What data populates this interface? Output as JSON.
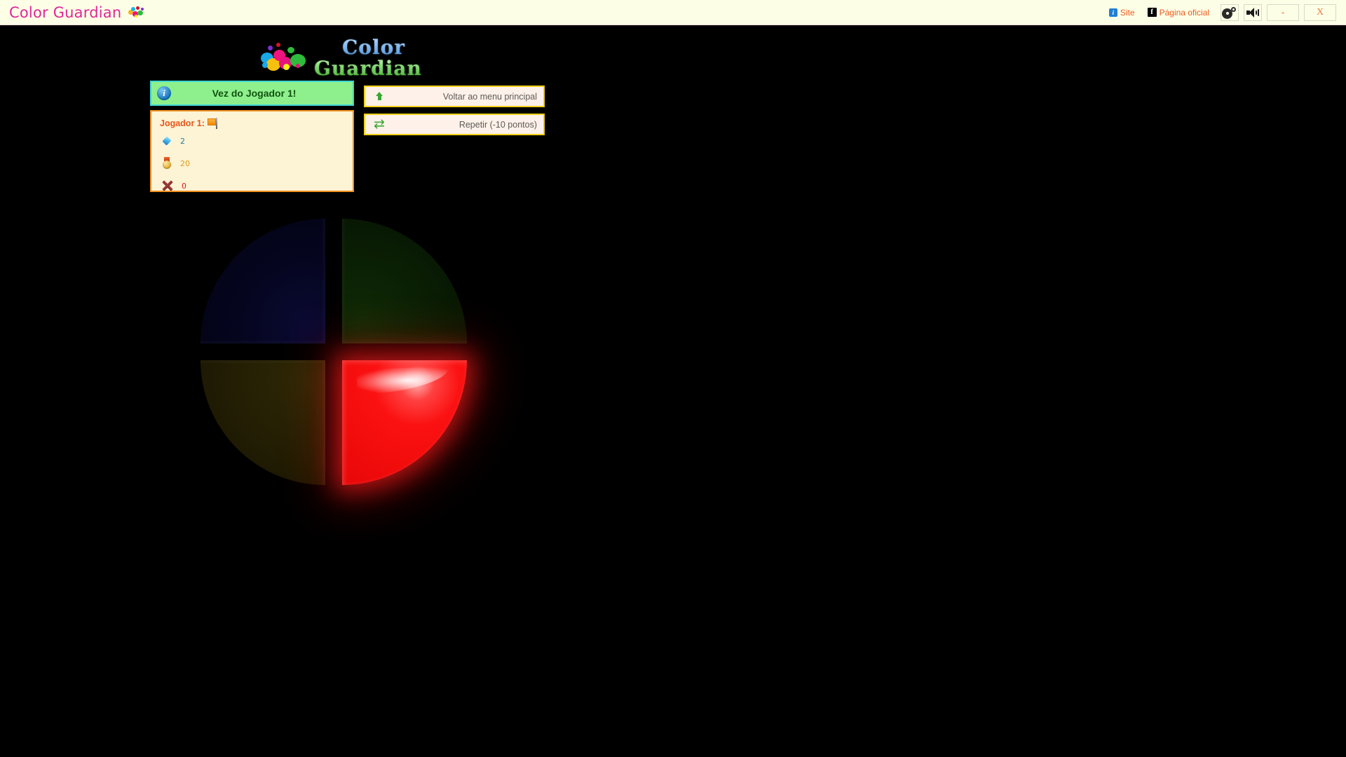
{
  "titlebar": {
    "app_title": "Color Guardian",
    "logo_icon": "paint-splatter-icon",
    "links": [
      {
        "label": "Site",
        "icon": "info-square-icon"
      },
      {
        "label": "Página oficial",
        "icon": "facebook-icon"
      }
    ],
    "buttons": [
      {
        "name": "settings-button",
        "icon": "gear-icon",
        "label": ""
      },
      {
        "name": "sound-button",
        "icon": "speaker-icon",
        "label": ""
      },
      {
        "name": "minimize-button",
        "icon": "minimize-icon",
        "label": "-"
      },
      {
        "name": "close-button",
        "icon": "close-icon",
        "label": "X"
      }
    ]
  },
  "logo": {
    "line1": "Color",
    "line2": "Guardian",
    "icon": "paint-splatter-icon"
  },
  "status": {
    "icon": "info-circle-icon",
    "text": "Vez do Jogador 1!",
    "banner_bg": "#8EF08D",
    "banner_border": "#3FD5D3"
  },
  "player_panel": {
    "player_label": "Jogador 1:",
    "flag_icon": "flag-icon",
    "panel_bg": "#FDF3D5",
    "panel_border": "#F0901E",
    "stats": [
      {
        "icon": "gem-icon",
        "value": "2",
        "color": "#1A7F9E"
      },
      {
        "icon": "medal-icon",
        "value": "20",
        "color": "#E09A16"
      },
      {
        "icon": "x-mark-icon",
        "value": "0",
        "color": "#E01B1B"
      }
    ]
  },
  "actions": [
    {
      "name": "back-to-main-menu-button",
      "label": "Voltar ao menu principal",
      "icon": "up-arrow-icon"
    },
    {
      "name": "repeat-button",
      "label": "Repetir (-10 pontos)",
      "icon": "refresh-icon"
    }
  ],
  "game_board": {
    "type": "simon-color-wheel",
    "quadrants": [
      {
        "name": "blue-quadrant",
        "position": "top-left",
        "color": "#030318",
        "active": "false"
      },
      {
        "name": "green-quadrant",
        "position": "top-right",
        "color": "#0A1C04",
        "active": "false"
      },
      {
        "name": "yellow-quadrant",
        "position": "bottom-left",
        "color": "#231F04",
        "active": "false"
      },
      {
        "name": "red-quadrant",
        "position": "bottom-right",
        "color": "#FC1111",
        "active": "true"
      }
    ]
  }
}
